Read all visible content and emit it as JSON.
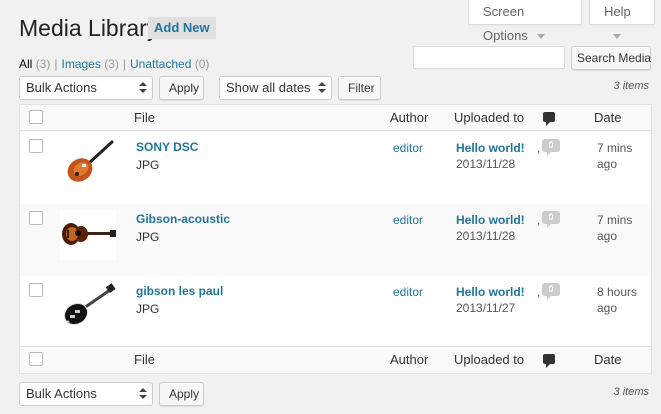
{
  "header": {
    "title": "Media Library",
    "add_new": "Add New",
    "screen_options": "Screen Options",
    "help": "Help"
  },
  "filters": {
    "all_label": "All",
    "all_count": "(3)",
    "images_label": "Images",
    "images_count": "(3)",
    "unattached_label": "Unattached",
    "unattached_count": "(0)",
    "sep": "|"
  },
  "search": {
    "button": "Search Media",
    "value": "",
    "placeholder": ""
  },
  "toolbar_top": {
    "bulk_actions": "Bulk Actions",
    "apply": "Apply",
    "dates": "Show all dates",
    "filter": "Filter",
    "items": "3 items"
  },
  "toolbar_bottom": {
    "bulk_actions": "Bulk Actions",
    "apply": "Apply",
    "items": "3 items"
  },
  "columns": {
    "file": "File",
    "author": "Author",
    "uploaded_to": "Uploaded to",
    "date": "Date"
  },
  "rows": [
    {
      "name": "SONY DSC",
      "type": "JPG",
      "author": "editor",
      "uploaded_to": "Hello world!",
      "upload_date": "2013/11/28",
      "comments": "0",
      "date_line1": "7 mins",
      "date_line2": "ago",
      "thumb": "electric-hollow-guitar"
    },
    {
      "name": "Gibson-acoustic",
      "type": "JPG",
      "author": "editor",
      "uploaded_to": "Hello world!",
      "upload_date": "2013/11/28",
      "comments": "0",
      "date_line1": "7 mins",
      "date_line2": "ago",
      "thumb": "acoustic-guitar"
    },
    {
      "name": "gibson les paul",
      "type": "JPG",
      "author": "editor",
      "uploaded_to": "Hello world!",
      "upload_date": "2013/11/27",
      "comments": "0",
      "date_line1": "8 hours",
      "date_line2": "ago",
      "thumb": "les-paul-guitar"
    }
  ],
  "colors": {
    "link": "#21759b",
    "bubble": "#cccccc",
    "background": "#f1f1f1"
  }
}
